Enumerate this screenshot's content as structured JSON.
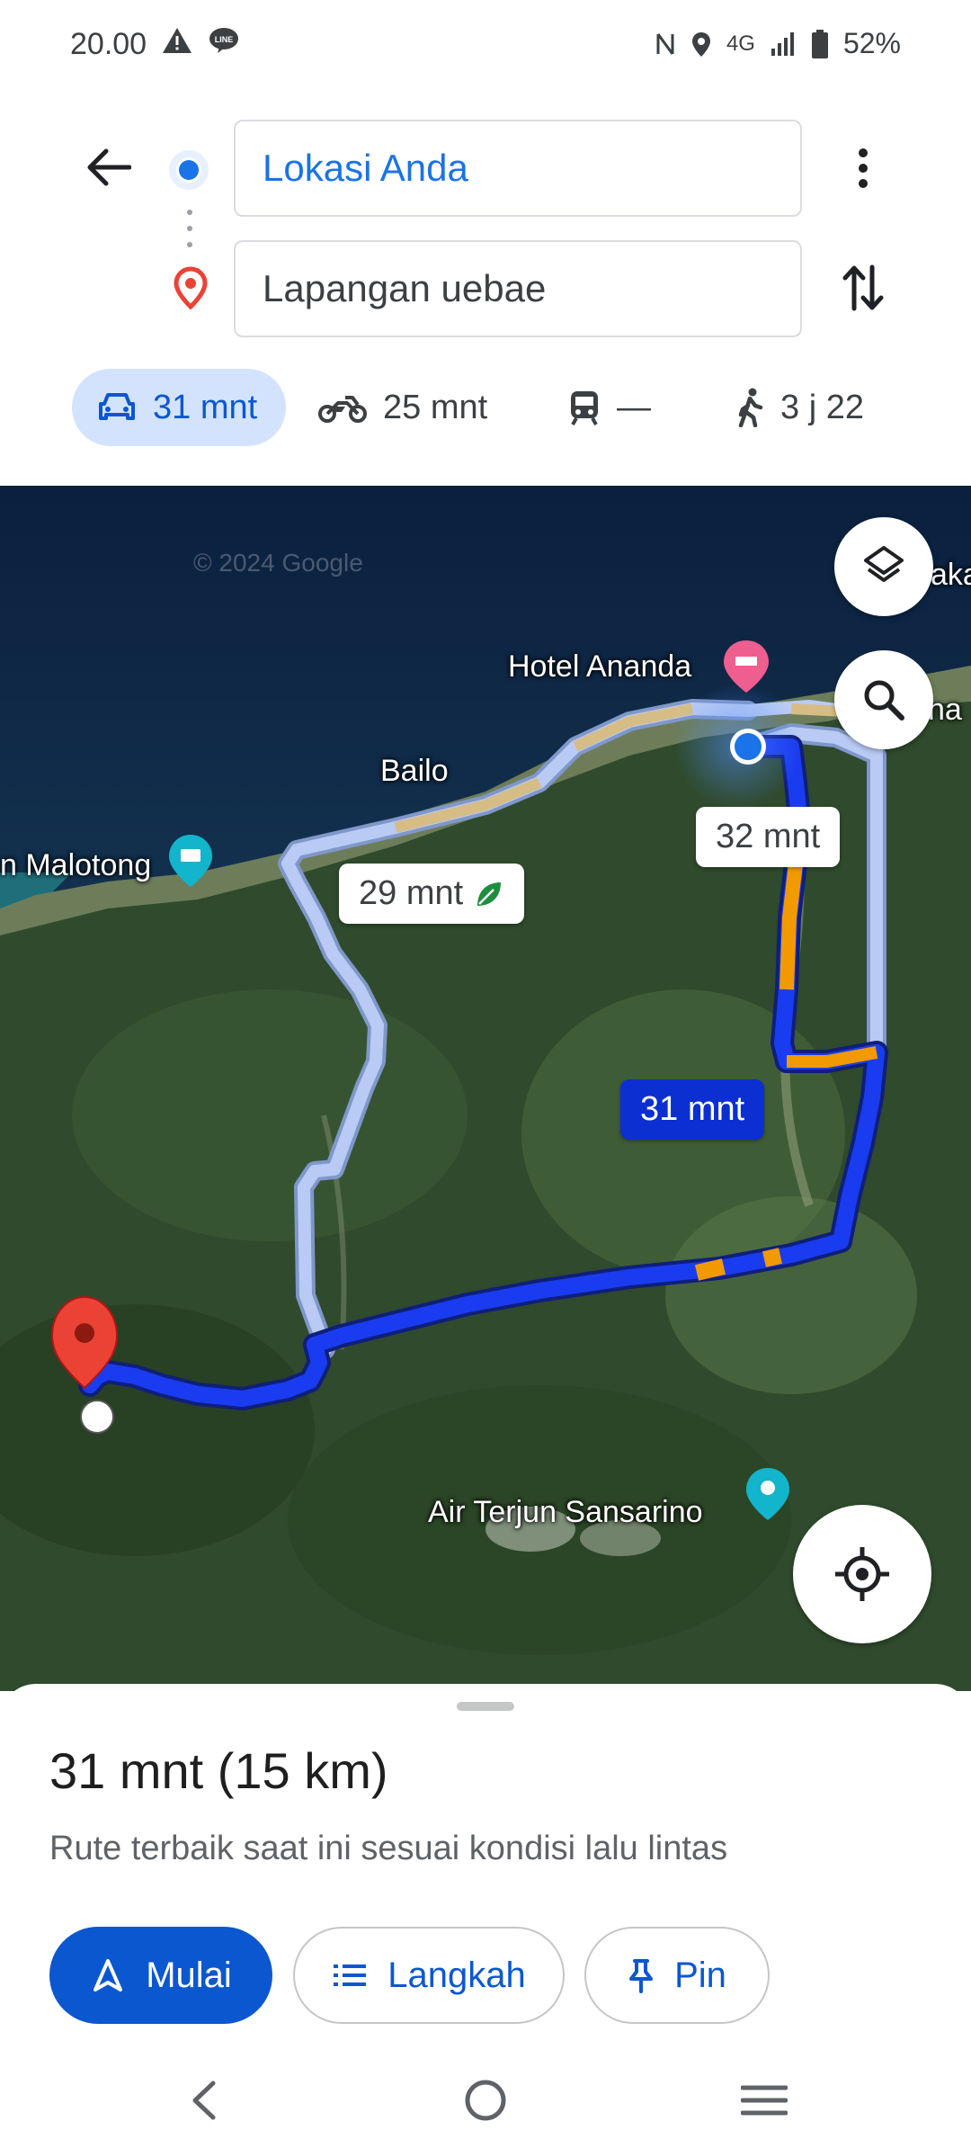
{
  "status_bar": {
    "time": "20.00",
    "network": "4G",
    "battery": "52%",
    "icons": [
      "warning-icon",
      "line-app-icon",
      "nfc-icon",
      "location-icon",
      "signal-icon",
      "battery-icon"
    ]
  },
  "directions": {
    "origin": "Lokasi Anda",
    "destination": "Lapangan uebae"
  },
  "modes": [
    {
      "name": "drive",
      "icon": "car-icon",
      "label": "31 mnt",
      "active": true
    },
    {
      "name": "motorcycle",
      "icon": "motorcycle-icon",
      "label": "25 mnt"
    },
    {
      "name": "transit",
      "icon": "train-icon",
      "label": "—"
    },
    {
      "name": "walk",
      "icon": "walk-icon",
      "label": "3 j 22"
    }
  ],
  "map": {
    "watermark": "© 2024 Google",
    "places": {
      "hotel": "Hotel Ananda",
      "bailo": "Bailo",
      "malotong": "n Malotong",
      "waterfall": "Air Terjun Sansarino",
      "edge_top": "aka",
      "edge_mid": "A",
      "edge_mid2": "na"
    },
    "route_labels": {
      "alt1": "29 mnt",
      "alt2": "32 mnt",
      "primary": "31 mnt"
    },
    "colors": {
      "primary_route": "#1a3cf0",
      "alt_route": "#a9bdf5",
      "traffic_slow": "#f29900",
      "origin_dot": "#1a73e8",
      "dest_pin": "#ea4335"
    }
  },
  "summary": {
    "title": "31 mnt (15 km)",
    "subtitle": "Rute terbaik saat ini sesuai kondisi lalu lintas",
    "buttons": {
      "start": "Mulai",
      "steps": "Langkah",
      "pin": "Pin"
    }
  }
}
